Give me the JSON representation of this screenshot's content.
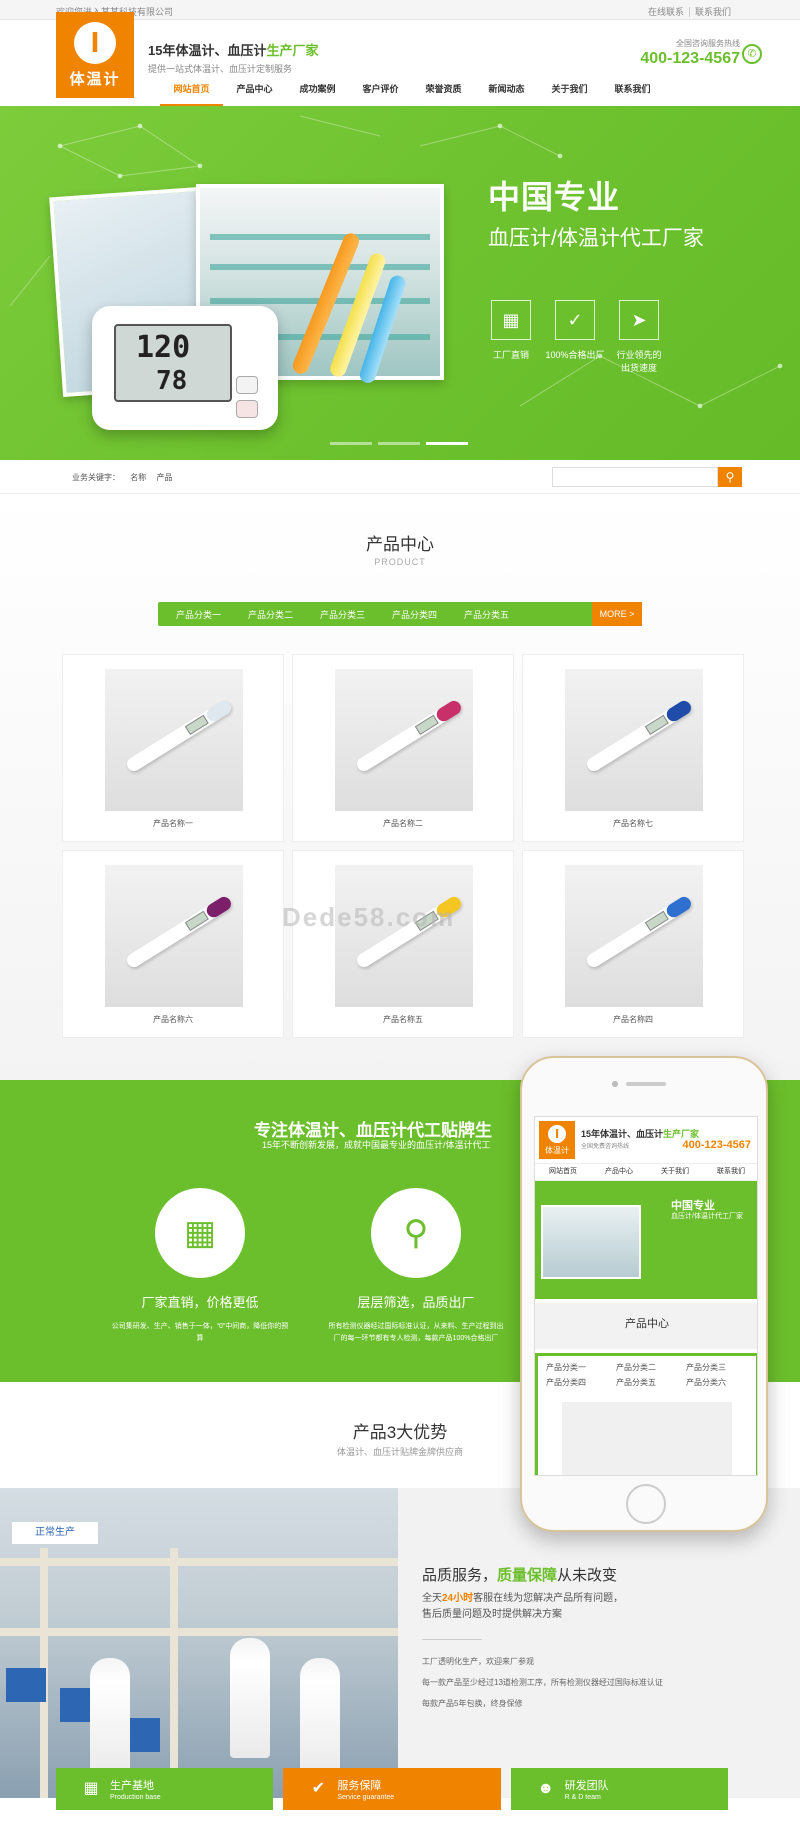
{
  "topbar": {
    "welcome": "欢迎您进入某某科技有限公司",
    "links": [
      "在线联系",
      "联系我们"
    ]
  },
  "header": {
    "logo_text": "体温计",
    "slogan_main": "15年体温计、血压计",
    "slogan_accent": "生产厂家",
    "slogan_sub": "提供一站式体温计、血压计定制服务",
    "hotline_label": "全国咨询服务热线",
    "hotline": "400-123-4567"
  },
  "nav": [
    "网站首页",
    "产品中心",
    "成功案例",
    "客户评价",
    "荣誉资质",
    "新闻动态",
    "关于我们",
    "联系我们"
  ],
  "banner": {
    "title1": "中国专业",
    "title2": "血压计/体温计代工厂家",
    "bp_values": [
      "120",
      "78"
    ],
    "features": [
      {
        "label": "工厂直销",
        "icon": "factory-icon"
      },
      {
        "label": "100%合格出厂",
        "icon": "check-clipboard-icon"
      },
      {
        "label": "行业领先的",
        "label2": "出货速度",
        "icon": "rocket-icon"
      }
    ],
    "slides": 3,
    "active_slide": 2
  },
  "search": {
    "label": "业务关键字：",
    "keywords": [
      "名称",
      "产品"
    ],
    "placeholder": ""
  },
  "products": {
    "title": "产品中心",
    "title_en": "PRODUCT",
    "categories": [
      "产品分类一",
      "产品分类二",
      "产品分类三",
      "产品分类四",
      "产品分类五"
    ],
    "more": "MORE >",
    "items": [
      {
        "name": "产品名称一",
        "cap": "#dfe8ef"
      },
      {
        "name": "产品名称二",
        "cap": "#c8306a"
      },
      {
        "name": "产品名称七",
        "cap": "#1f4ca8"
      },
      {
        "name": "产品名称六",
        "cap": "#7b1f6b"
      },
      {
        "name": "产品名称五",
        "cap": "#f5c521"
      },
      {
        "name": "产品名称四",
        "cap": "#2f6fd0"
      }
    ],
    "watermark": "Dede58.com"
  },
  "band": {
    "title": "专注体温计、血压计代工贴牌生",
    "subtitle": "15年不断创新发展，成就中国最专业的血压计/体温计代工",
    "features": [
      {
        "title": "厂家直销，价格更低",
        "desc": "公司集研发、生产、销售于一体，“0”中间商，降低你的预算",
        "icon": "building-icon"
      },
      {
        "title": "层层筛选，品质出厂",
        "desc": "所有检测仪器经过国际标准认证，从来料、生产过程到出厂的每一环节都有专人检测，每款产品100%合格出厂",
        "icon": "chart-search-icon"
      }
    ]
  },
  "mobile": {
    "logo": "体温计",
    "slogan_main": "15年体温计、血压计",
    "slogan_accent": "生产厂家",
    "slogan_sub": "全国免费咨询热线",
    "tel": "400-123-4567",
    "nav": [
      "网站首页",
      "产品中心",
      "关于我们",
      "联系我们"
    ],
    "banner_title": "中国专业",
    "banner_sub": "血压计/体温计代工厂家",
    "prod_title": "产品中心",
    "cats": [
      "产品分类一",
      "产品分类二",
      "产品分类三",
      "产品分类四",
      "产品分类五",
      "产品分类六"
    ]
  },
  "advantages": {
    "title": "产品3大优势",
    "subtitle": "体温计、血压计贴牌金牌供应商",
    "factory_sign": "正常生产",
    "heading_a": "品质服务，",
    "heading_b": "质量保障",
    "heading_c": "从未改变",
    "p1a": "全天",
    "p1b": "24小时",
    "p1c": "客服在线为您解决产品所有问题，",
    "p2": "售后质量问题及时提供解决方案",
    "list": [
      "工厂透明化生产，欢迎来厂参观",
      "每一款产品至少经过13道检测工序，所有检测仪器经过国际标准认证",
      "每款产品5年包换，终身保修"
    ],
    "tabs": [
      {
        "cn": "生产基地",
        "en": "Production base",
        "icon": "factory-base-icon"
      },
      {
        "cn": "服务保障",
        "en": "Service guarantee",
        "icon": "shield-check-icon"
      },
      {
        "cn": "研发团队",
        "en": "R & D team",
        "icon": "team-icon"
      }
    ]
  },
  "colors": {
    "green": "#6cbf2c",
    "orange": "#f08300"
  }
}
